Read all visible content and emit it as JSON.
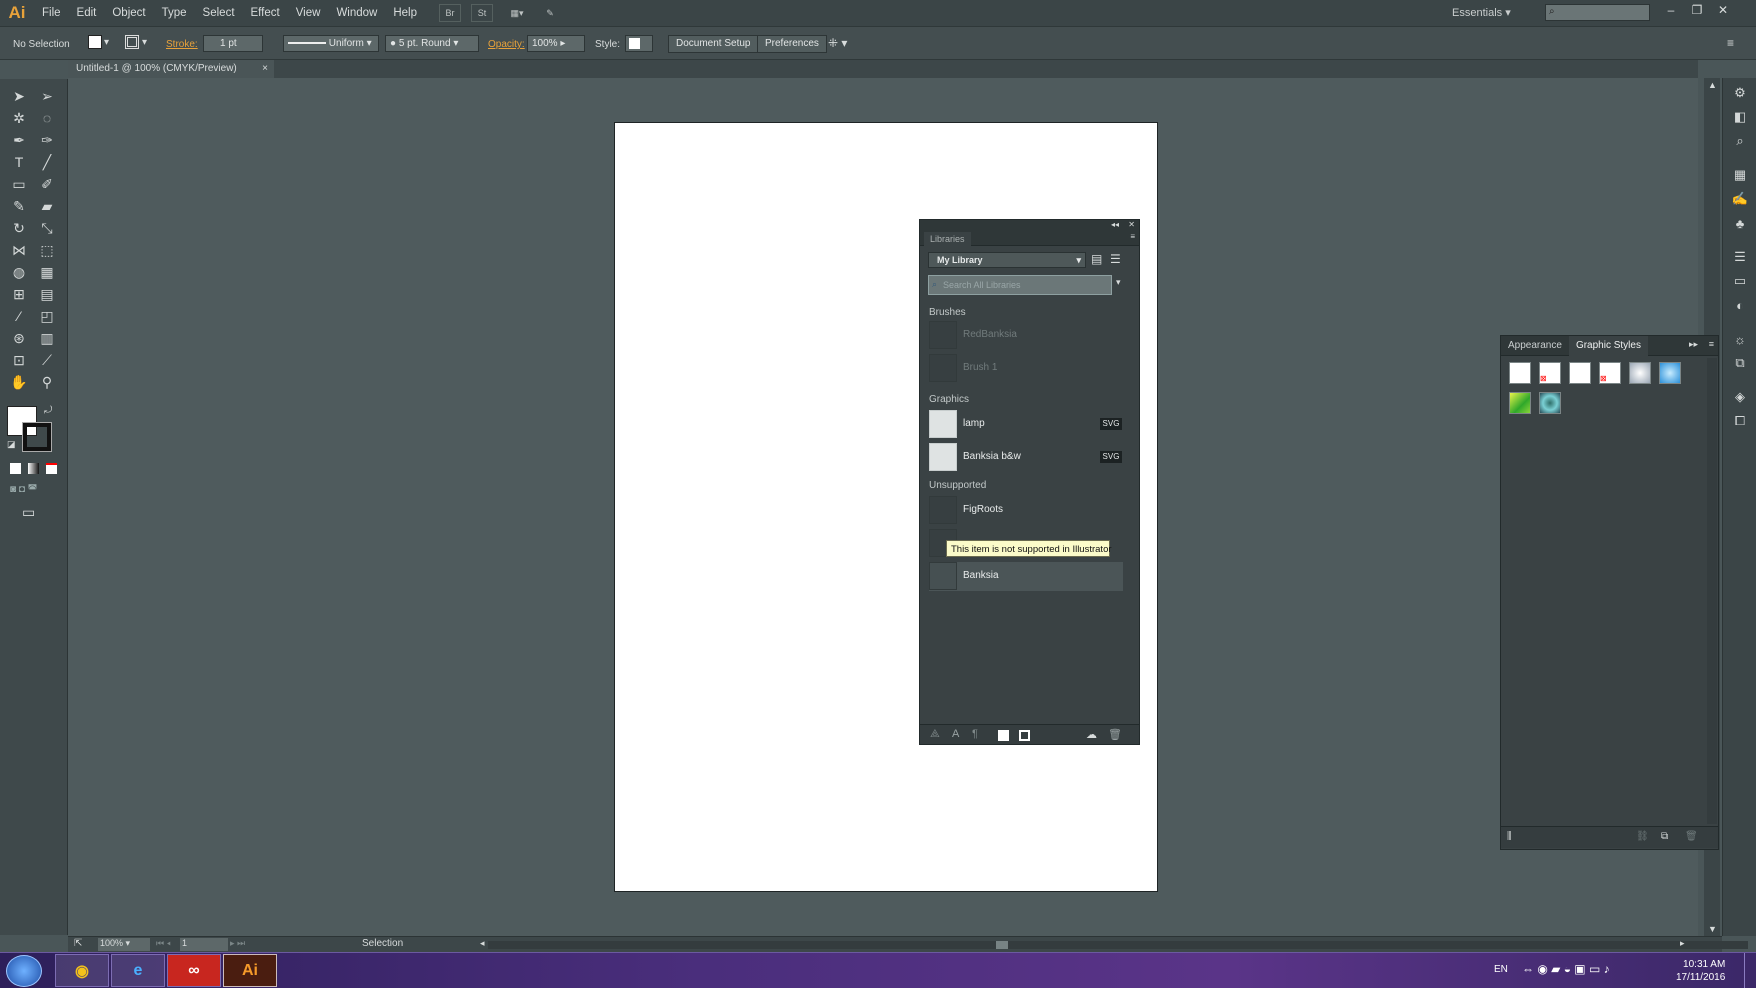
{
  "app": {
    "logo": "Ai"
  },
  "menubar": {
    "items": [
      "File",
      "Edit",
      "Object",
      "Type",
      "Select",
      "Effect",
      "View",
      "Window",
      "Help"
    ],
    "workspace": "Essentials",
    "search_placeholder": ""
  },
  "controlbar": {
    "selection": "No Selection",
    "stroke_label": "Stroke:",
    "stroke_value": "1 pt",
    "profile": "Uniform",
    "brush": "5 pt. Round",
    "opacity_label": "Opacity:",
    "opacity_value": "100%",
    "style_label": "Style:",
    "doc_setup": "Document Setup",
    "preferences": "Preferences"
  },
  "document": {
    "tab_title": "Untitled-1 @ 100% (CMYK/Preview)"
  },
  "statusbar": {
    "zoom": "100%",
    "page": "1",
    "tool": "Selection"
  },
  "libraries": {
    "tab": "Libraries",
    "selected_library": "My Library",
    "search_placeholder": "Search All Libraries",
    "sections": {
      "brushes": "Brushes",
      "graphics": "Graphics",
      "unsupported": "Unsupported"
    },
    "brushes": [
      "RedBanksia",
      "Brush 1"
    ],
    "graphics": [
      {
        "name": "lamp",
        "badge": "SVG"
      },
      {
        "name": "Banksia b&w",
        "badge": "SVG"
      }
    ],
    "unsupported": [
      "FigRoots",
      "",
      "Banksia"
    ],
    "tooltip": "This item is not supported in Illustrator"
  },
  "graphic_styles": {
    "tabs": [
      "Appearance",
      "Graphic Styles"
    ],
    "active_tab": "Graphic Styles"
  },
  "taskbar": {
    "lang": "EN",
    "time": "10:31 AM",
    "date": "17/11/2016"
  },
  "colors": {
    "accent_orange": "#e8a23a",
    "panel_bg": "#3a4244",
    "canvas_bg": "#4f5b5d"
  }
}
